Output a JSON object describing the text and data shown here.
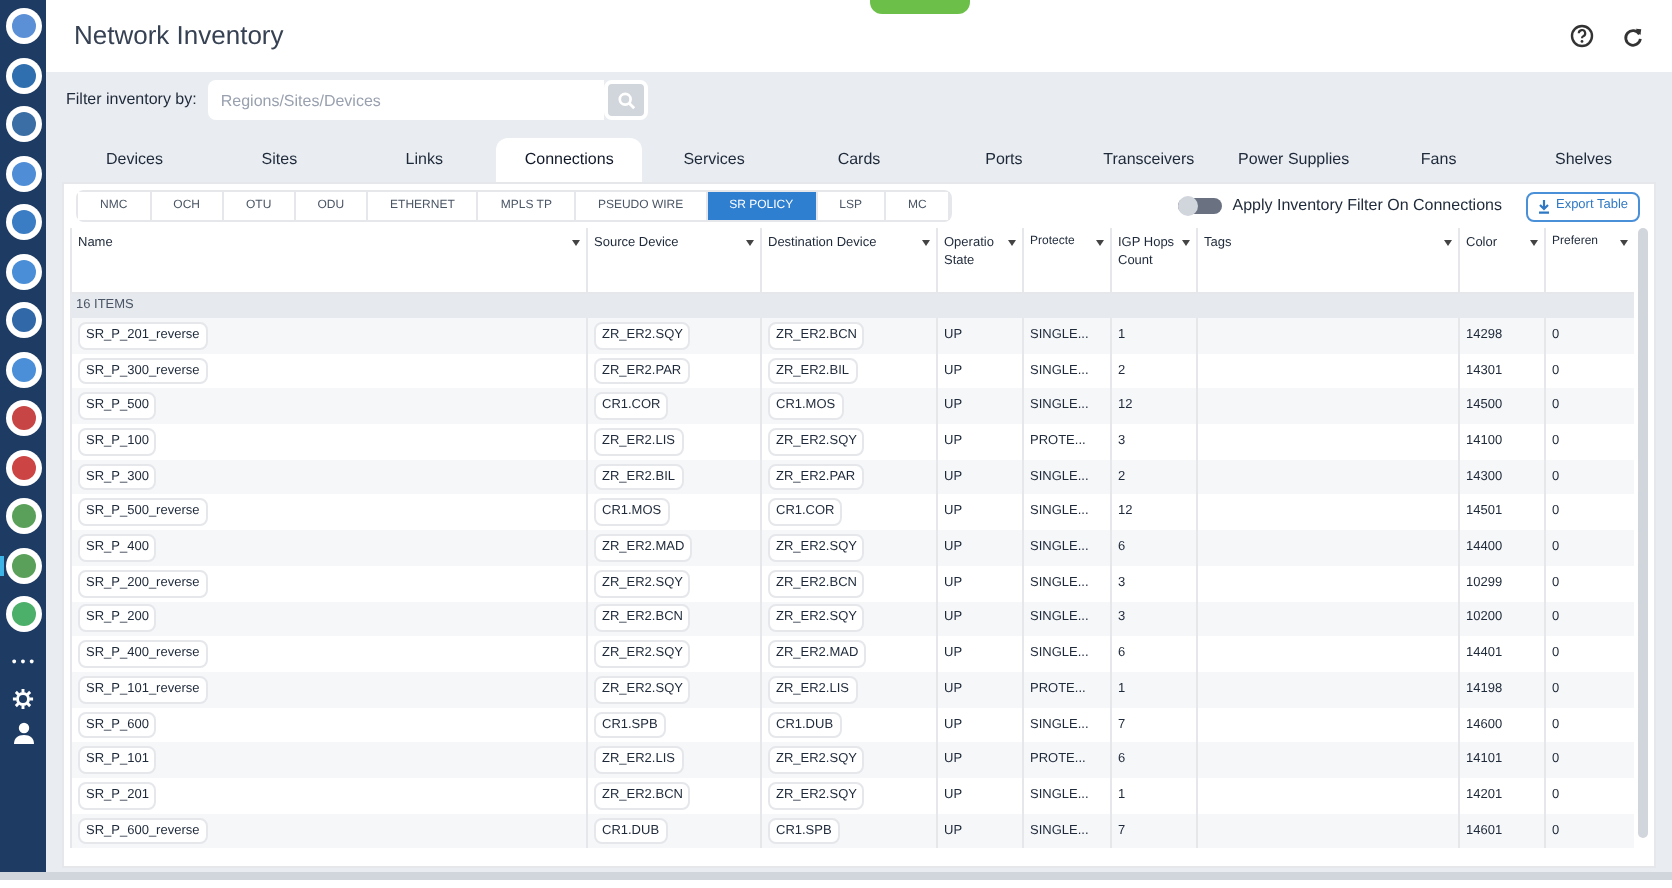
{
  "window": {
    "title": "Network Inventory"
  },
  "sidebar": {
    "items": [
      {
        "selected": false
      },
      {
        "selected": false
      },
      {
        "selected": false
      },
      {
        "selected": false
      },
      {
        "selected": false
      },
      {
        "selected": false
      },
      {
        "selected": false
      },
      {
        "selected": false
      },
      {
        "selected": false
      },
      {
        "selected": false
      },
      {
        "selected": false
      },
      {
        "selected": true
      },
      {
        "selected": false
      }
    ],
    "more": "• • •"
  },
  "filter": {
    "label": "Filter inventory by:",
    "placeholder": "Regions/Sites/Devices"
  },
  "tabs": [
    {
      "label": "Devices",
      "selected": false
    },
    {
      "label": "Sites",
      "selected": false
    },
    {
      "label": "Links",
      "selected": false
    },
    {
      "label": "Connections",
      "selected": true
    },
    {
      "label": "Services",
      "selected": false
    },
    {
      "label": "Cards",
      "selected": false
    },
    {
      "label": "Ports",
      "selected": false
    },
    {
      "label": "Transceivers",
      "selected": false
    },
    {
      "label": "Power Supplies",
      "selected": false
    },
    {
      "label": "Fans",
      "selected": false
    },
    {
      "label": "Shelves",
      "selected": false
    }
  ],
  "subtabs": [
    {
      "label": "NMC",
      "selected": false
    },
    {
      "label": "OCH",
      "selected": false
    },
    {
      "label": "OTU",
      "selected": false
    },
    {
      "label": "ODU",
      "selected": false
    },
    {
      "label": "ETHERNET",
      "selected": false
    },
    {
      "label": "MPLS TP",
      "selected": false
    },
    {
      "label": "PSEUDO WIRE",
      "selected": false
    },
    {
      "label": "SR POLICY",
      "selected": true
    },
    {
      "label": "LSP",
      "selected": false
    },
    {
      "label": "MC",
      "selected": false
    }
  ],
  "toggle": {
    "label": "Apply Inventory Filter On Connections",
    "on": false
  },
  "export_button": "Export Table",
  "table": {
    "columns": [
      "Name",
      "Source Device",
      "Destination Device",
      "Operatio State",
      "Protecte",
      "IGP Hops Count",
      "Tags",
      "Color",
      "Preferen"
    ],
    "group": "16 ITEMS",
    "rows": [
      [
        "SR_P_201_reverse",
        "ZR_ER2.SQY",
        "ZR_ER2.BCN",
        "UP",
        "SINGLE...",
        "1",
        "",
        "14298",
        "0"
      ],
      [
        "SR_P_300_reverse",
        "ZR_ER2.PAR",
        "ZR_ER2.BIL",
        "UP",
        "SINGLE...",
        "2",
        "",
        "14301",
        "0"
      ],
      [
        "SR_P_500",
        "CR1.COR",
        "CR1.MOS",
        "UP",
        "SINGLE...",
        "12",
        "",
        "14500",
        "0"
      ],
      [
        "SR_P_100",
        "ZR_ER2.LIS",
        "ZR_ER2.SQY",
        "UP",
        "PROTE...",
        "3",
        "",
        "14100",
        "0"
      ],
      [
        "SR_P_300",
        "ZR_ER2.BIL",
        "ZR_ER2.PAR",
        "UP",
        "SINGLE...",
        "2",
        "",
        "14300",
        "0"
      ],
      [
        "SR_P_500_reverse",
        "CR1.MOS",
        "CR1.COR",
        "UP",
        "SINGLE...",
        "12",
        "",
        "14501",
        "0"
      ],
      [
        "SR_P_400",
        "ZR_ER2.MAD",
        "ZR_ER2.SQY",
        "UP",
        "SINGLE...",
        "6",
        "",
        "14400",
        "0"
      ],
      [
        "SR_P_200_reverse",
        "ZR_ER2.SQY",
        "ZR_ER2.BCN",
        "UP",
        "SINGLE...",
        "3",
        "",
        "10299",
        "0"
      ],
      [
        "SR_P_200",
        "ZR_ER2.BCN",
        "ZR_ER2.SQY",
        "UP",
        "SINGLE...",
        "3",
        "",
        "10200",
        "0"
      ],
      [
        "SR_P_400_reverse",
        "ZR_ER2.SQY",
        "ZR_ER2.MAD",
        "UP",
        "SINGLE...",
        "6",
        "",
        "14401",
        "0"
      ],
      [
        "SR_P_101_reverse",
        "ZR_ER2.SQY",
        "ZR_ER2.LIS",
        "UP",
        "PROTE...",
        "1",
        "",
        "14198",
        "0"
      ],
      [
        "SR_P_600",
        "CR1.SPB",
        "CR1.DUB",
        "UP",
        "SINGLE...",
        "7",
        "",
        "14600",
        "0"
      ],
      [
        "SR_P_101",
        "ZR_ER2.LIS",
        "ZR_ER2.SQY",
        "UP",
        "PROTE...",
        "6",
        "",
        "14101",
        "0"
      ],
      [
        "SR_P_201",
        "ZR_ER2.BCN",
        "ZR_ER2.SQY",
        "UP",
        "SINGLE...",
        "1",
        "",
        "14201",
        "0"
      ],
      [
        "SR_P_600_reverse",
        "CR1.DUB",
        "CR1.SPB",
        "UP",
        "SINGLE...",
        "7",
        "",
        "14601",
        "0"
      ]
    ]
  }
}
